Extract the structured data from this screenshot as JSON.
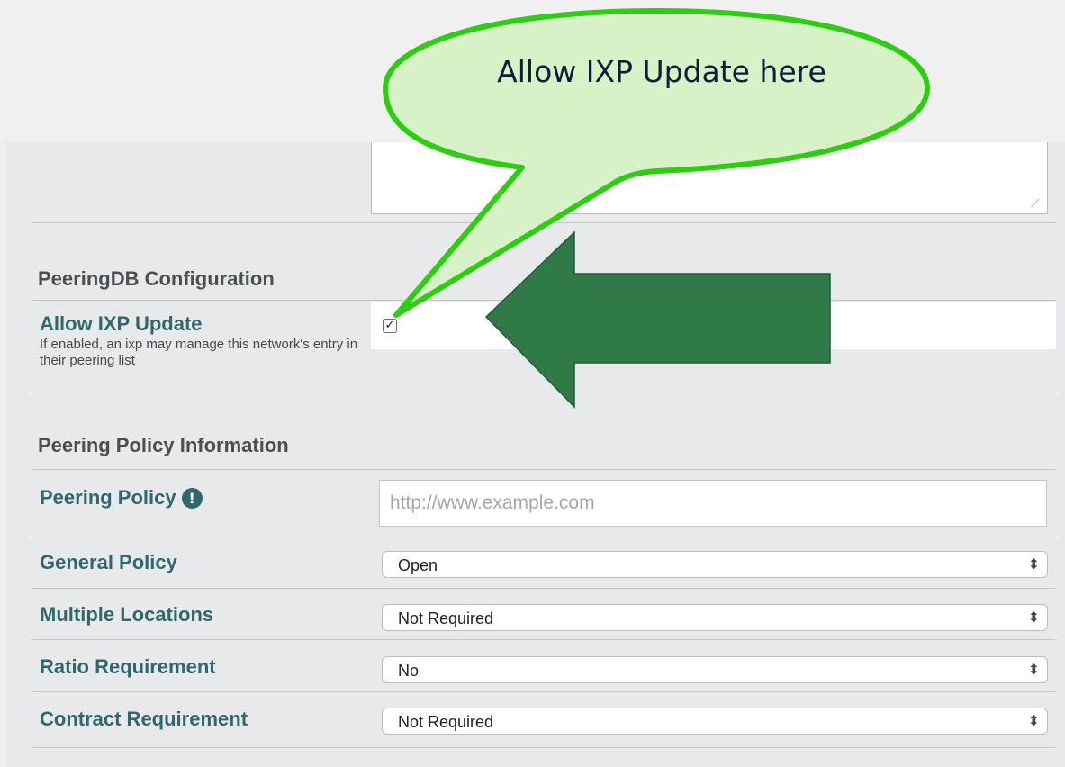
{
  "callout": {
    "text": "Allow IXP Update here",
    "bubble_color": "#d6f2c6",
    "outline_color": "#2ecc12"
  },
  "arrow": {
    "color": "#2f7a47",
    "direction": "left"
  },
  "form": {
    "textarea_value": "",
    "peeringdb_configuration": {
      "heading": "PeeringDB Configuration",
      "allow_ixp_update": {
        "label": "Allow IXP Update",
        "help": "If enabled, an ixp may manage this network's entry in their peering list",
        "checked": true,
        "check_glyph": "✓"
      }
    },
    "peering_policy_information": {
      "heading": "Peering Policy Information",
      "peering_policy": {
        "label": "Peering Policy",
        "placeholder": "http://www.example.com",
        "value": "",
        "info_icon": "!"
      },
      "general_policy": {
        "label": "General Policy",
        "value": "Open"
      },
      "multiple_locations": {
        "label": "Multiple Locations",
        "value": "Not Required"
      },
      "ratio_requirement": {
        "label": "Ratio Requirement",
        "value": "No"
      },
      "contract_requirement": {
        "label": "Contract Requirement",
        "value": "Not Required"
      }
    }
  },
  "colors": {
    "label_teal": "#30676d",
    "heading_gray": "#4b4f52",
    "panel_bg": "#e8e9ea"
  }
}
